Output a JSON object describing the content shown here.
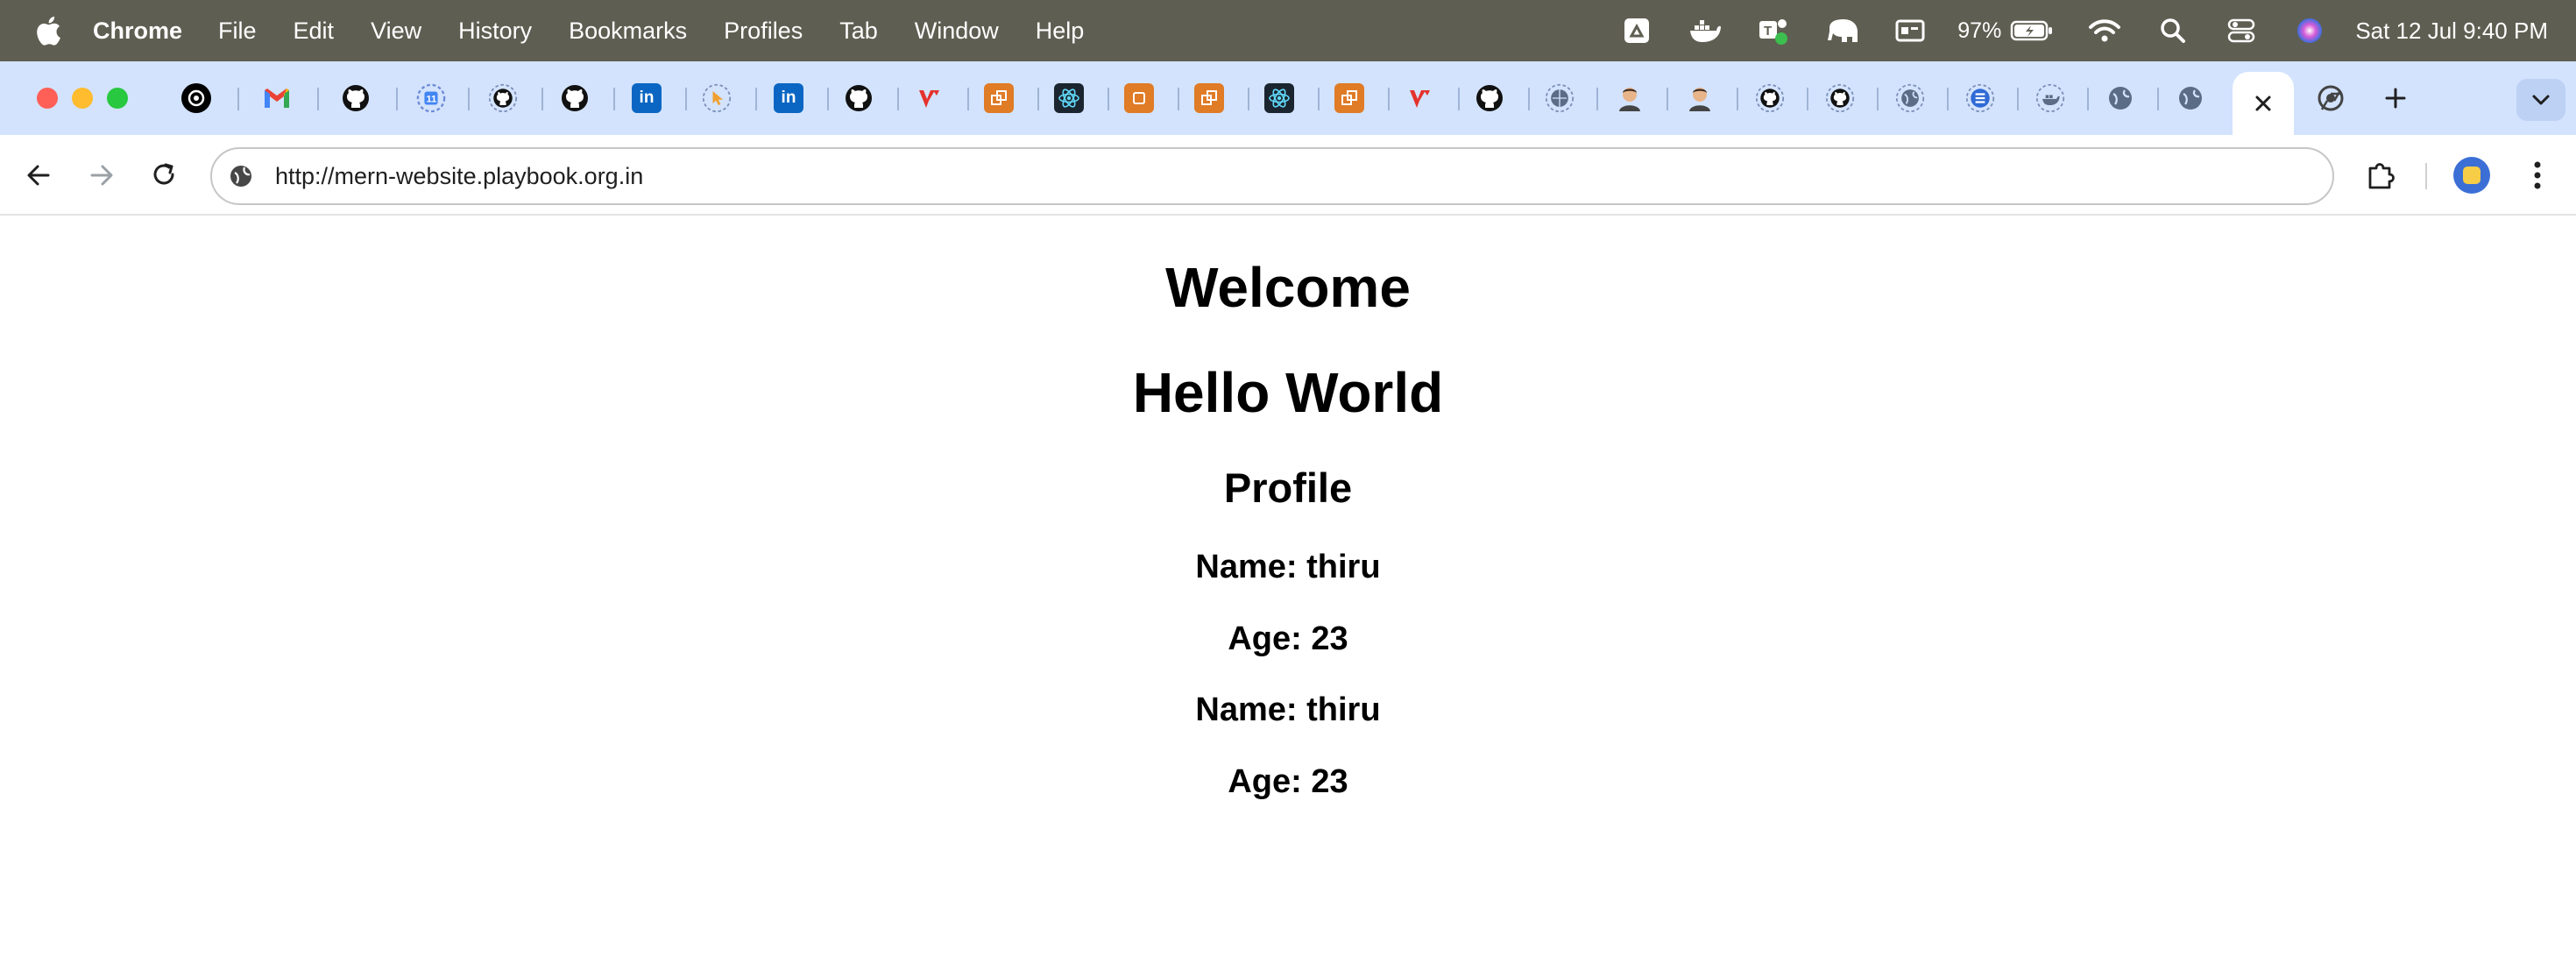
{
  "menubar": {
    "app_name": "Chrome",
    "items": [
      "File",
      "Edit",
      "View",
      "History",
      "Bookmarks",
      "Profiles",
      "Tab",
      "Window",
      "Help"
    ],
    "battery_percent": "97%",
    "clock": "Sat 12 Jul  9:40 PM"
  },
  "tabs": [
    {
      "icon": "openai-icon"
    },
    {
      "icon": "gmail-icon"
    },
    {
      "icon": "github-icon"
    },
    {
      "icon": "calendar-icon"
    },
    {
      "icon": "github-icon"
    },
    {
      "icon": "github-icon"
    },
    {
      "icon": "linkedin-icon"
    },
    {
      "icon": "pointer-icon"
    },
    {
      "icon": "linkedin-icon"
    },
    {
      "icon": "github-icon"
    },
    {
      "icon": "vercel-red-icon"
    },
    {
      "icon": "orange-app-icon"
    },
    {
      "icon": "react-icon"
    },
    {
      "icon": "orange-app-icon"
    },
    {
      "icon": "orange-app-icon"
    },
    {
      "icon": "react-icon"
    },
    {
      "icon": "orange-app-icon"
    },
    {
      "icon": "vercel-red-icon"
    },
    {
      "icon": "github-icon"
    },
    {
      "icon": "docker-globe-icon"
    },
    {
      "icon": "avatar-icon"
    },
    {
      "icon": "avatar-icon"
    },
    {
      "icon": "github-icon"
    },
    {
      "icon": "github-icon"
    },
    {
      "icon": "globe-icon"
    },
    {
      "icon": "list-icon"
    },
    {
      "icon": "docker-globe-icon"
    },
    {
      "icon": "globe-icon"
    },
    {
      "icon": "globe-icon"
    },
    {
      "icon": "close-icon",
      "active": true
    },
    {
      "icon": "chrome-icon"
    }
  ],
  "address_bar": {
    "url": "http://mern-website.playbook.org.in"
  },
  "page": {
    "title": "Welcome",
    "heading": "Hello World",
    "section": "Profile",
    "profiles": [
      {
        "name": "Name: thiru",
        "age": "Age: 23"
      },
      {
        "name": "Name: thiru",
        "age": "Age: 23"
      }
    ]
  },
  "colors": {
    "menubar_bg": "#5f5e52",
    "tabstrip_bg": "#d3e3fd",
    "text": "#000000"
  }
}
